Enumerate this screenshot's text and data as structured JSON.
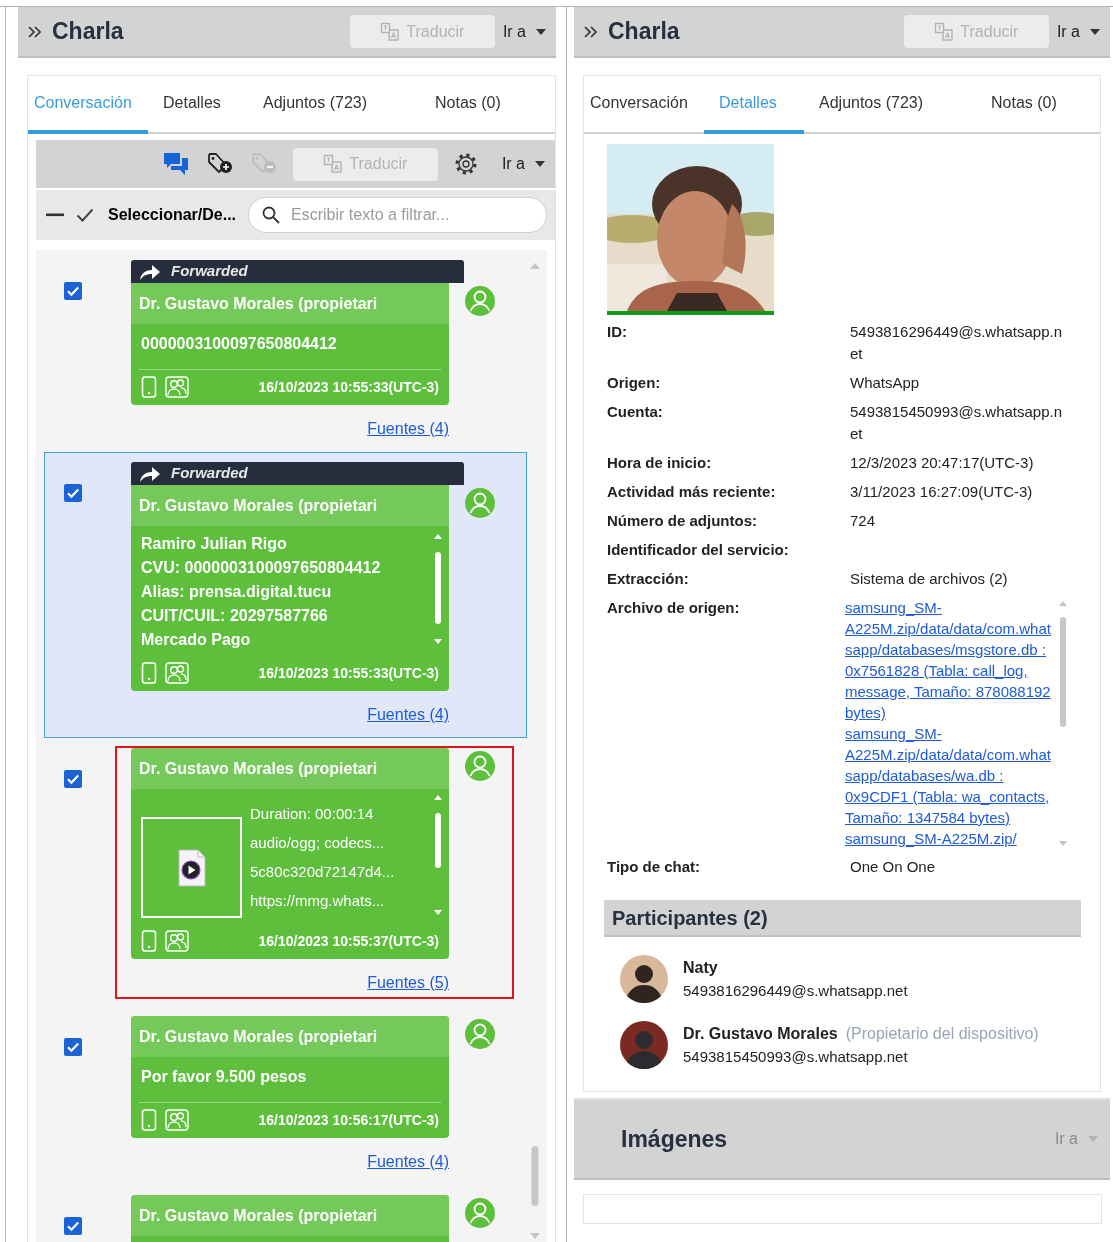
{
  "left_panel": {
    "title": "Charla",
    "translate_button": {
      "label": "Traducir",
      "disabled": true
    },
    "goto_menu": {
      "label": "Ir a",
      "disabled": false
    },
    "tabs": [
      {
        "label": "Conversación",
        "selected": true
      },
      {
        "label": "Detalles",
        "selected": false
      },
      {
        "label": "Adjuntos (723)",
        "selected": false
      },
      {
        "label": "Notas (0)",
        "selected": false
      }
    ],
    "toolbar": {
      "add_tag": {
        "disabled": false
      },
      "remove_tag": {
        "disabled": true
      },
      "translate_button": {
        "label": "Traducir",
        "disabled": true
      },
      "goto_menu": {
        "label": "Ir a",
        "disabled": false
      }
    },
    "select_toggle": "Seleccionar/De...",
    "search": {
      "placeholder": "Escribir texto a filtrar..."
    },
    "messages": [
      {
        "checked": true,
        "selected": false,
        "highlighted": false,
        "forwarded_label": "Forwarded",
        "sender": "Dr. Gustavo Morales (propietari",
        "kind": "text",
        "body": "0000003100097650804412",
        "timestamp": "16/10/2023 10:55:33(UTC-3)",
        "sources": "Fuentes (4)"
      },
      {
        "checked": true,
        "selected": true,
        "highlighted": false,
        "forwarded_label": "Forwarded",
        "sender": "Dr. Gustavo Morales (propietari",
        "kind": "scroll_text",
        "body": "Ramiro Julian Rigo\nCVU: 0000003100097650804412\nAlias: prensa.digital.tucu\nCUIT/CUIL: 20297587766\nMercado Pago",
        "timestamp": "16/10/2023 10:55:33(UTC-3)",
        "sources": "Fuentes (4)"
      },
      {
        "checked": true,
        "selected": false,
        "highlighted": true,
        "sender": "Dr. Gustavo Morales (propietari",
        "kind": "audio",
        "attachment": [
          "Duration: 00:00:14",
          "audio/ogg; codecs...",
          "5c80c320d72147d4...",
          "https://mmg.whats..."
        ],
        "timestamp": "16/10/2023 10:55:37(UTC-3)",
        "sources": "Fuentes (5)"
      },
      {
        "checked": true,
        "selected": false,
        "highlighted": false,
        "sender": "Dr. Gustavo Morales (propietari",
        "kind": "text",
        "body": "Por favor 9.500 pesos",
        "timestamp": "16/10/2023 10:56:17(UTC-3)",
        "sources": "Fuentes (4)"
      },
      {
        "checked": true,
        "selected": false,
        "highlighted": false,
        "sender": "Dr. Gustavo Morales (propietari",
        "kind": "text"
      }
    ]
  },
  "right_panel": {
    "title": "Charla",
    "translate_button": {
      "label": "Traducir",
      "disabled": true
    },
    "goto_menu": {
      "label": "Ir a",
      "disabled": false
    },
    "tabs": [
      {
        "label": "Conversación",
        "selected": false
      },
      {
        "label": "Detalles",
        "selected": true
      },
      {
        "label": "Adjuntos (723)",
        "selected": false
      },
      {
        "label": "Notas (0)",
        "selected": false
      }
    ],
    "details": [
      {
        "label": "ID:",
        "value": "5493816296449@s.whatsapp.net"
      },
      {
        "label": "Origen:",
        "value": "WhatsApp"
      },
      {
        "label": "Cuenta:",
        "value": "5493815450993@s.whatsapp.net"
      },
      {
        "label": "Hora de inicio:",
        "value": "12/3/2023 20:47:17(UTC-3)"
      },
      {
        "label": "Actividad más reciente:",
        "value": "3/11/2023 16:27:09(UTC-3)"
      },
      {
        "label": "Número de adjuntos:",
        "value": "724"
      },
      {
        "label": "Identificador del servicio:"
      },
      {
        "label": "Extracción:",
        "value": "Sistema de archivos (2)"
      },
      {
        "label": "Archivo de origen:",
        "links": [
          "samsung_SM-A225M.zip/data/data/com.whatsapp/databases/msgstore.db : 0x7561828 (Tabla: call_log, message, Tamaño: 878088192 bytes)",
          "samsung_SM-A225M.zip/data/data/com.whatsapp/databases/wa.db : 0x9CDF1 (Tabla: wa_contacts, Tamaño: 1347584 bytes)",
          "samsung_SM-A225M.zip/"
        ]
      },
      {
        "label": "Tipo de chat:",
        "value": "One On One"
      }
    ],
    "participants": {
      "title": "Participantes (2)",
      "items": [
        {
          "name": "Naty",
          "id": "5493816296449@s.whatsapp.net"
        },
        {
          "name": "Dr. Gustavo Morales",
          "note": "(Propietario del dispositivo)",
          "id": "5493815450993@s.whatsapp.net"
        }
      ]
    },
    "images_section": {
      "title": "Imágenes",
      "goto_menu": {
        "label": "Ir a",
        "disabled": true
      }
    }
  }
}
